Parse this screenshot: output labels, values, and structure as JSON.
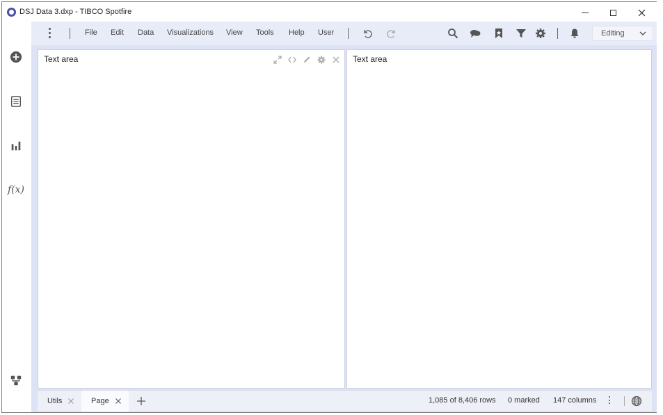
{
  "window": {
    "title": "DSJ Data 3.dxp - TIBCO Spotfire"
  },
  "menu": {
    "items": [
      "File",
      "Edit",
      "Data",
      "Visualizations",
      "View",
      "Tools",
      "Help",
      "User"
    ],
    "mode": "Editing"
  },
  "panels": [
    {
      "title": "Text area"
    },
    {
      "title": "Text area"
    }
  ],
  "pages": [
    {
      "label": "Utils"
    },
    {
      "label": "Page"
    }
  ],
  "status": {
    "rows": "1,085 of 8,406 rows",
    "marked": "0 marked",
    "columns": "147 columns"
  },
  "icons": {
    "rail": [
      "add-icon",
      "data-table-icon",
      "visualization-icon",
      "expression-icon",
      "data-canvas-icon"
    ],
    "toolbar": [
      "undo-icon",
      "redo-icon",
      "search-icon",
      "collaboration-icon",
      "bookmark-icon",
      "filter-icon",
      "settings-icon",
      "notification-icon"
    ]
  },
  "colors": {
    "frame": "#dde3f5",
    "menubar": "#e8ecf8",
    "accent": "#4a4fa8"
  }
}
